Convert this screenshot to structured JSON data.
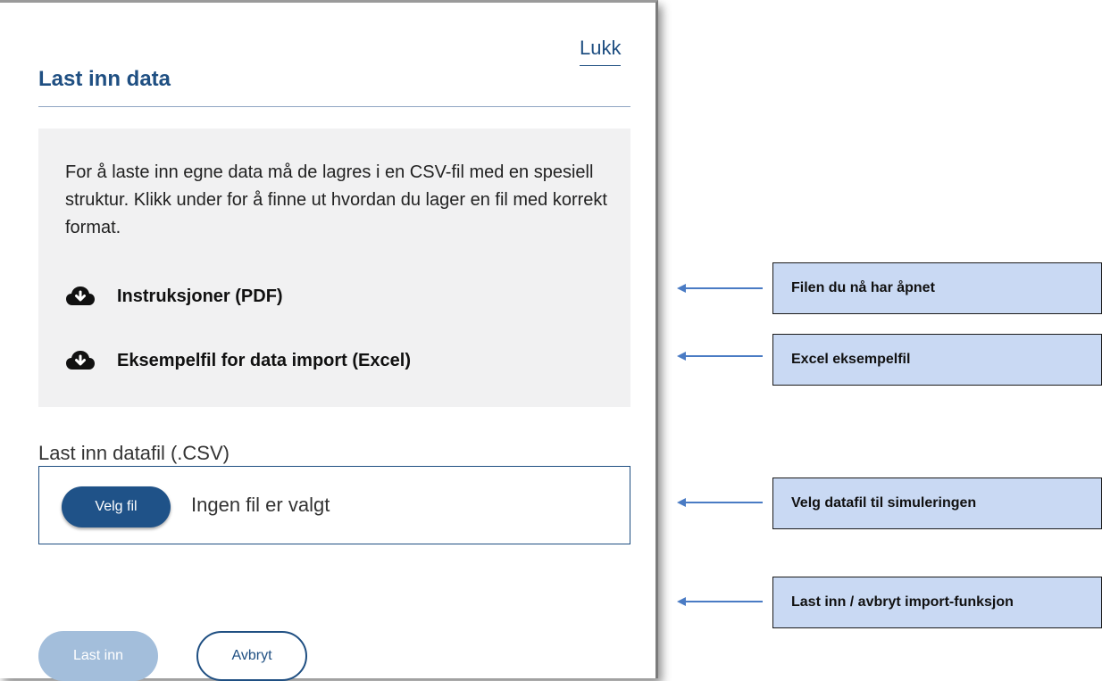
{
  "dialog": {
    "close_label": "Lukk",
    "title": "Last inn data",
    "info": {
      "text": "For å laste inn egne data må de lagres i en CSV-fil med en spesiell struktur. Klikk under for å finne ut hvordan du lager en fil med korrekt format.",
      "links": [
        {
          "icon": "cloud-download-icon",
          "label": "Instruksjoner (PDF)"
        },
        {
          "icon": "cloud-download-icon",
          "label": "Eksempelfil for data import (Excel)"
        }
      ]
    },
    "file_upload": {
      "label": "Last inn datafil (.CSV)",
      "button_label": "Velg fil",
      "status": "Ingen fil er valgt"
    },
    "actions": {
      "load_label": "Last inn",
      "cancel_label": "Avbryt"
    }
  },
  "annotations": [
    "Filen du nå har åpnet",
    "Excel eksempelfil",
    "Velg datafil til simuleringen",
    "Last inn / avbryt import-funksjon"
  ],
  "colors": {
    "brand": "#1f4f82",
    "callout_bg": "#c9d9f3",
    "arrow": "#4a7bc4",
    "disabled_button": "#a3bedb"
  }
}
